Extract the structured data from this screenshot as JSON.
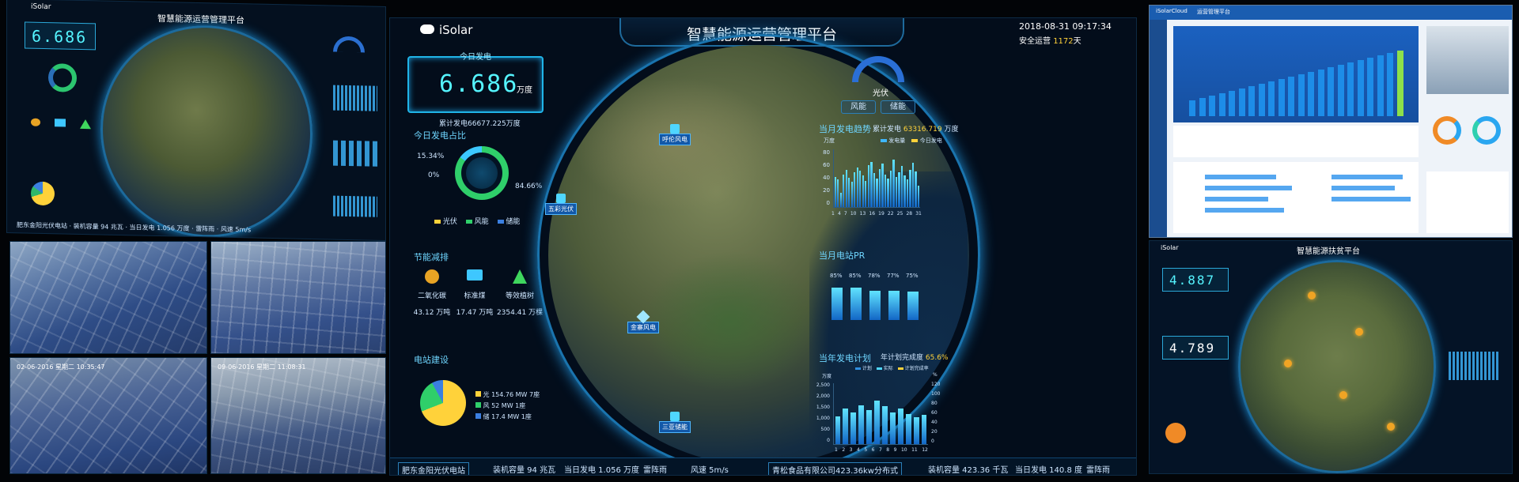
{
  "left_screen": {
    "brand": "iSolar",
    "title": "智慧能源运营管理平台",
    "counter": "6.686",
    "strip": [
      "肥东金阳光伏电站",
      "装机容量 94 兆瓦",
      "当日发电 1.056 万度",
      "雷阵雨",
      "风速 5m/s"
    ],
    "camera_labels": [
      "02-06-2016 星期二 10:35:47",
      "09-06-2016 星期二 11:08:31"
    ]
  },
  "center_screen": {
    "brand": "iSolar",
    "title": "智慧能源运营管理平台",
    "datetime": "2018-08-31 09:17:34",
    "safe_days_label": "安全运营",
    "safe_days_value": "1172",
    "safe_days_unit": "天",
    "today_label": "今日发电",
    "today_value": "6.686",
    "today_unit": "万度",
    "cumulative": "累计发电66677.225万度",
    "ratio_title": "今日发电占比",
    "ratio_left_top": "15.34%",
    "ratio_left": "0%",
    "ratio_right": "84.66%",
    "ratio_legend": [
      "光伏",
      "风能",
      "储能"
    ],
    "energy_title": "节能减排",
    "energy_items": [
      {
        "label": "二氧化碳",
        "value": "43.12 万吨",
        "icon": "co2-icon"
      },
      {
        "label": "标准煤",
        "value": "17.47 万吨",
        "icon": "coal-cart-icon"
      },
      {
        "label": "等效植树",
        "value": "2354.41 万棵",
        "icon": "tree-icon"
      }
    ],
    "build_title": "电站建设",
    "build_legend": [
      "光 154.76 MW 7座",
      "风 52 MW 1座",
      "储 17.4 MW 1座"
    ],
    "gauge_label": "光伏",
    "tabs": [
      "风能",
      "储能"
    ],
    "trend_title": "当月发电趋势",
    "trend_total_label": "累计发电",
    "trend_total_value": "63316.719",
    "trend_total_unit": "万度",
    "trend_unit": "万度",
    "trend_legend": [
      "发电量",
      "今日发电"
    ],
    "trend_y_ticks": [
      "80",
      "60",
      "40",
      "20",
      "0"
    ],
    "trend_x_ticks": [
      "1",
      "4",
      "7",
      "10",
      "13",
      "16",
      "19",
      "22",
      "25",
      "28",
      "31"
    ],
    "trend_values": [
      42,
      38,
      20,
      45,
      52,
      41,
      35,
      48,
      55,
      50,
      44,
      36,
      58,
      62,
      47,
      40,
      53,
      60,
      45,
      39,
      50,
      66,
      42,
      48,
      57,
      44,
      38,
      52,
      61,
      49,
      30
    ],
    "pr_title": "当月电站PR",
    "pr_values": [
      "85%",
      "85%",
      "78%",
      "77%",
      "75%"
    ],
    "pr_ratios": [
      0.85,
      0.85,
      0.78,
      0.77,
      0.75
    ],
    "pr_names": [
      "肥东金阳光伏",
      "三亚光伏",
      "金寨风电",
      "霍山光伏",
      "青松食品"
    ],
    "plan_title": "当年发电计划",
    "plan_rate_label": "年计划完成度",
    "plan_rate_value": "65.6%",
    "plan_legend": [
      "计划",
      "实际",
      "计划完成率"
    ],
    "plan_left_unit": "万度",
    "plan_right_unit": "%",
    "plan_y_ticks": [
      "2,500",
      "2,000",
      "1,500",
      "1,000",
      "500",
      "0"
    ],
    "plan_y2_ticks": [
      "120",
      "100",
      "80",
      "60",
      "40",
      "20",
      "0"
    ],
    "plan_x_ticks": [
      "1",
      "2",
      "3",
      "4",
      "5",
      "6",
      "7",
      "8",
      "9",
      "10",
      "11",
      "12"
    ],
    "plan_values": [
      1150,
      1450,
      1300,
      1600,
      1400,
      1800,
      1550,
      1300,
      1450,
      1250,
      1100,
      1200
    ],
    "map_markers": [
      "五彩光伏",
      "呼伦风电",
      "金寨风电",
      "三亚储能"
    ],
    "strip_a": [
      "肥东金阳光伏电站",
      "装机容量 94 兆瓦",
      "当日发电 1.056 万度",
      "雷阵雨",
      "风速 5m/s"
    ],
    "strip_b": [
      "青松食品有限公司423.36kw分布式",
      "装机容量 423.36 千瓦",
      "当日发电 140.8 度",
      "雷阵雨"
    ]
  },
  "right_top_screen": {
    "brand": "iSolarCloud",
    "header": "运营管理平台"
  },
  "right_bottom_screen": {
    "brand": "iSolar",
    "title": "智慧能源扶贫平台",
    "counter_a": "4.887",
    "counter_b": "4.789"
  }
}
